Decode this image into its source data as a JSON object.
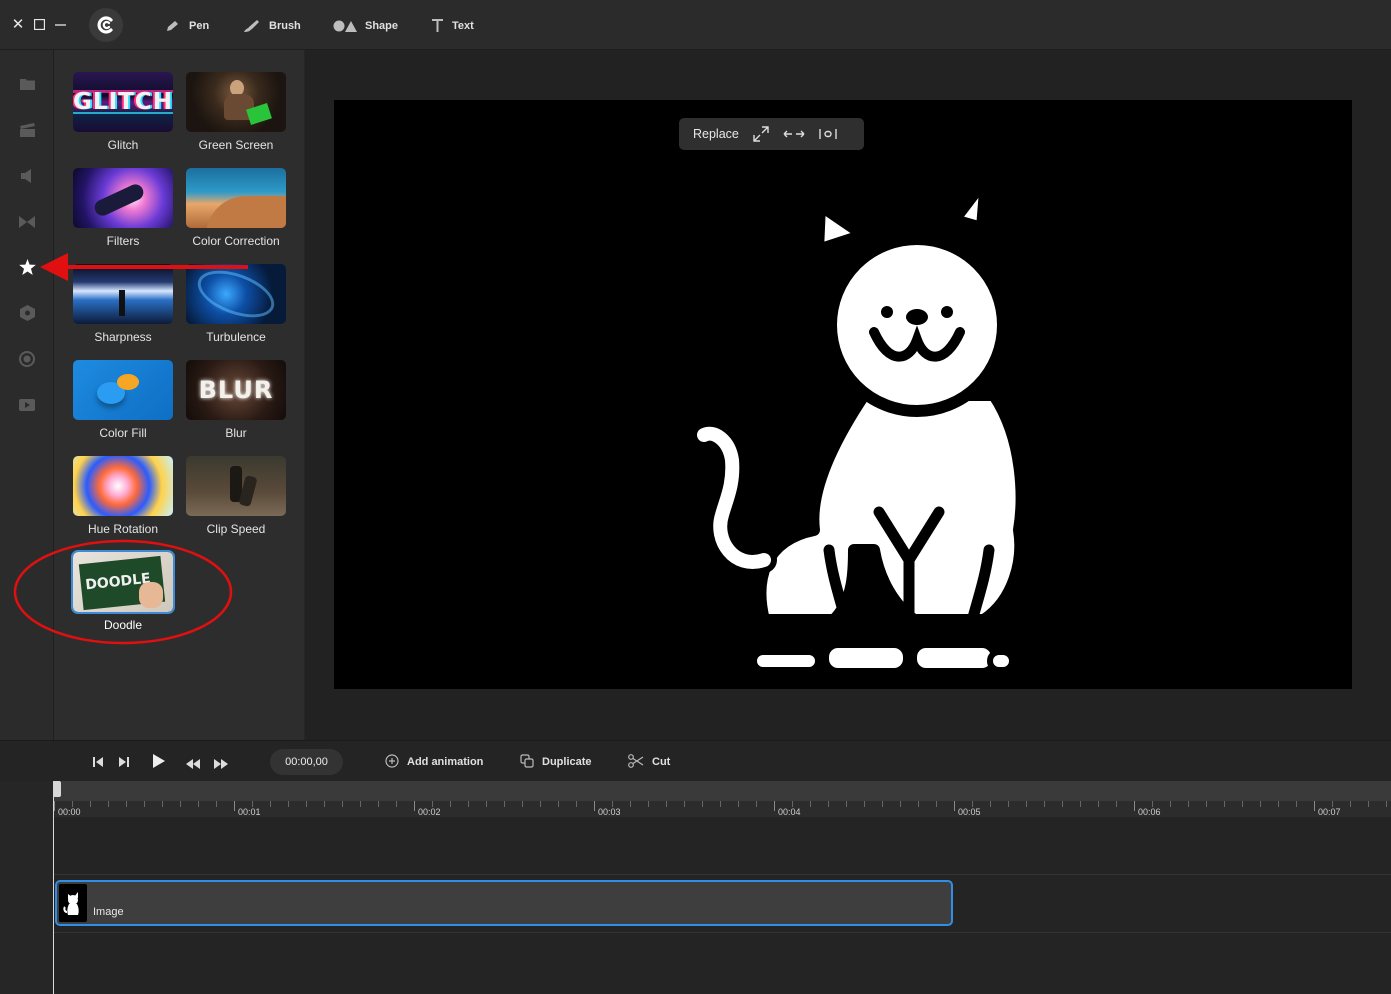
{
  "toolbar": {
    "tools": [
      {
        "label": "Pen",
        "icon": "pen-icon"
      },
      {
        "label": "Brush",
        "icon": "brush-icon"
      },
      {
        "label": "Shape",
        "icon": "shape-icon"
      },
      {
        "label": "Text",
        "icon": "text-icon"
      }
    ]
  },
  "effects": [
    {
      "label": "Glitch",
      "thumb_text": "GLITCH"
    },
    {
      "label": "Green Screen"
    },
    {
      "label": "Filters"
    },
    {
      "label": "Color Correction"
    },
    {
      "label": "Sharpness"
    },
    {
      "label": "Turbulence"
    },
    {
      "label": "Color Fill"
    },
    {
      "label": "Blur",
      "thumb_text": "BLUR"
    },
    {
      "label": "Hue Rotation"
    },
    {
      "label": "Clip Speed"
    },
    {
      "label": "Doodle",
      "thumb_text": "DOODLE",
      "selected": true
    }
  ],
  "preview": {
    "replace_label": "Replace"
  },
  "timeline": {
    "timecode": "00:00,00",
    "add_animation_label": "Add animation",
    "duplicate_label": "Duplicate",
    "cut_label": "Cut",
    "ruler_labels": [
      "00:00",
      "00:01",
      "00:02",
      "00:03",
      "00:04",
      "00:05",
      "00:06",
      "00:07"
    ],
    "clip_label": "Image"
  },
  "colors": {
    "accent": "#2f8fe6",
    "annotation": "#e01010"
  }
}
